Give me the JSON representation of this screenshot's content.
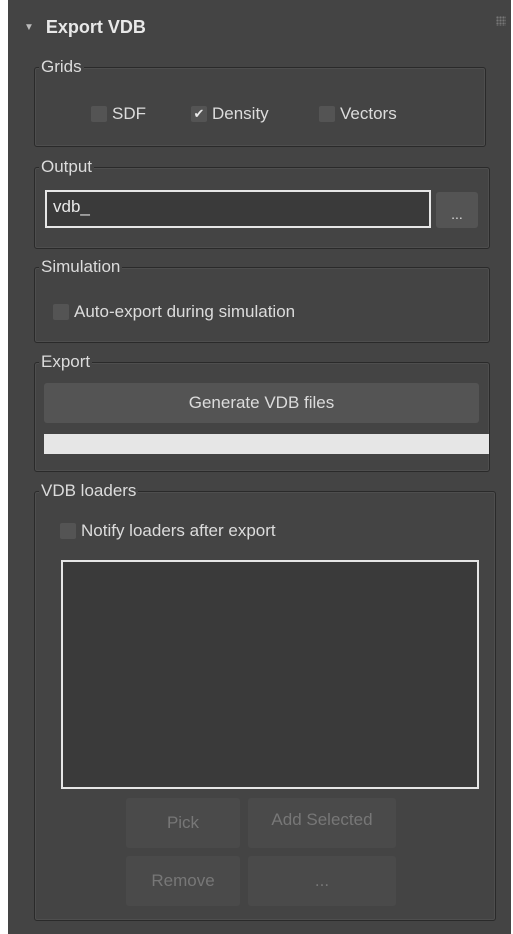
{
  "rollout": {
    "title": "Export VDB",
    "arrow": "▼"
  },
  "grids": {
    "title": "Grids",
    "options": [
      {
        "label": "SDF",
        "checked": false
      },
      {
        "label": "Density",
        "checked": true
      },
      {
        "label": "Vectors",
        "checked": false
      }
    ]
  },
  "output": {
    "title": "Output",
    "value": "vdb_",
    "browse_label": "..."
  },
  "simulation": {
    "title": "Simulation",
    "auto_export_label": "Auto-export during simulation",
    "auto_export_checked": false
  },
  "export": {
    "title": "Export",
    "generate_label": "Generate VDB files",
    "progress": 0
  },
  "loaders": {
    "title": "VDB loaders",
    "notify_label": "Notify loaders after export",
    "notify_checked": false,
    "pick_label": "Pick",
    "add_selected_label": "Add Selected",
    "remove_label": "Remove",
    "more_label": "..."
  },
  "colors": {
    "panel": "#444444",
    "field_border": "#e6e6e6",
    "text": "#dcdcdc"
  }
}
